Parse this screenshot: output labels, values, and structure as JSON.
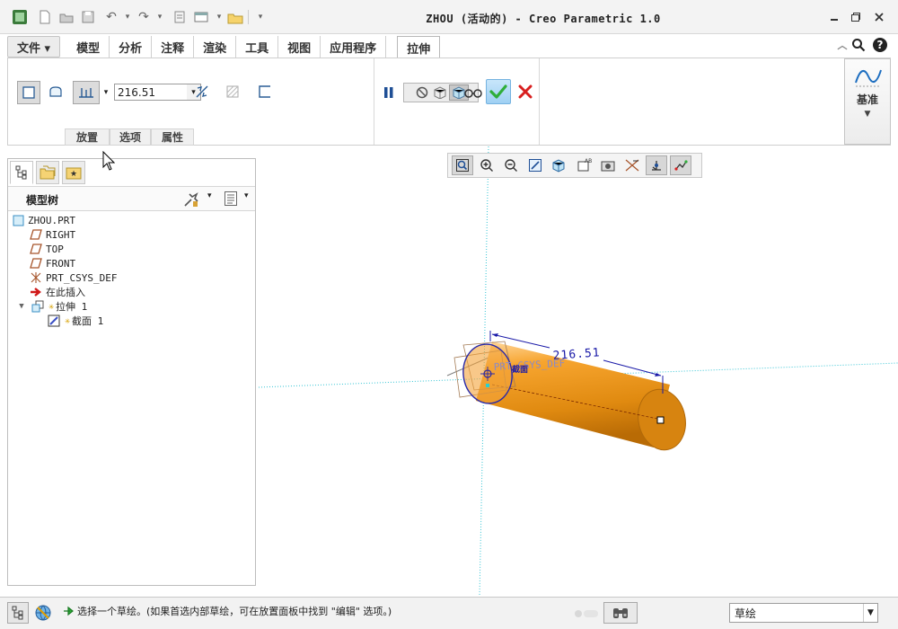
{
  "window": {
    "title": "ZHOU (活动的) - Creo Parametric 1.0",
    "minimize_icon": "minimize-icon",
    "restore_icon": "restore-icon",
    "close_icon": "close-icon"
  },
  "ribbon": {
    "tabs": [
      {
        "label": "文件 ▾",
        "kind": "file"
      },
      {
        "label": "模型"
      },
      {
        "label": "分析"
      },
      {
        "label": "注释"
      },
      {
        "label": "渲染"
      },
      {
        "label": "工具"
      },
      {
        "label": "视图"
      },
      {
        "label": "应用程序"
      },
      {
        "label": "拉伸",
        "active": true
      }
    ],
    "depth_value": "216.51",
    "group_labels": [
      "放置",
      "选项",
      "属性"
    ],
    "datum_label": "基准",
    "accent_green": "#2fae3a",
    "cancel_red": "#d81f1f"
  },
  "panel": {
    "title": "模型树",
    "tree": [
      {
        "label": "ZHOU.PRT",
        "icon": "part-icon"
      },
      {
        "label": "RIGHT",
        "icon": "datum-plane-icon"
      },
      {
        "label": "TOP",
        "icon": "datum-plane-icon"
      },
      {
        "label": "FRONT",
        "icon": "datum-plane-icon"
      },
      {
        "label": "PRT_CSYS_DEF",
        "icon": "csys-icon"
      },
      {
        "label": "在此插入",
        "icon": "insert-arrow-icon"
      },
      {
        "label": "拉伸 1",
        "icon": "extrude-icon"
      },
      {
        "label": "截面 1",
        "icon": "sketch-icon"
      }
    ]
  },
  "canvas": {
    "dimension_text": "216.51",
    "csys_label": "PRT_CSYS_DEF",
    "section_tag": "截面",
    "solid_color": "#e8900e"
  },
  "status": {
    "message": "选择一个草绘。(如果首选内部草绘，可在放置面板中找到 \"编辑\" 选项。)",
    "filter_value": "草绘"
  }
}
